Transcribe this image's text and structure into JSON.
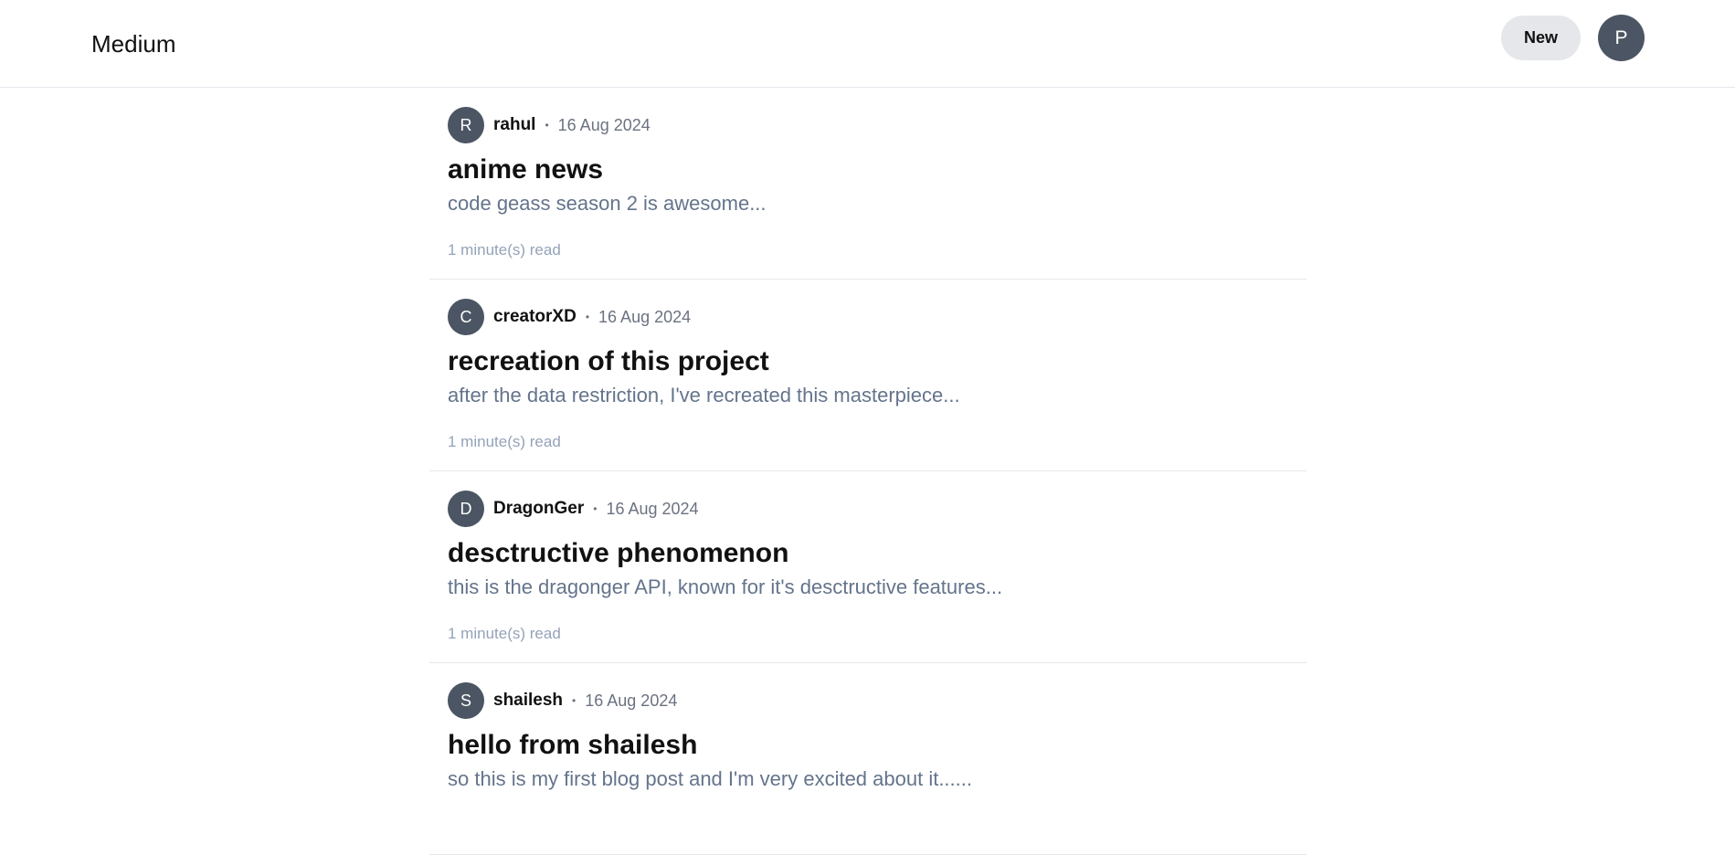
{
  "header": {
    "brand": "Medium",
    "new_label": "New",
    "profile_initial": "P"
  },
  "posts": [
    {
      "initial": "R",
      "author": "rahul",
      "separator": "•",
      "date": "16 Aug 2024",
      "title": "anime news",
      "excerpt": "code geass season 2 is awesome...",
      "read_time": "1 minute(s) read"
    },
    {
      "initial": "C",
      "author": "creatorXD",
      "separator": "•",
      "date": "16 Aug 2024",
      "title": "recreation of this project",
      "excerpt": "after the data restriction, I've recreated this masterpiece...",
      "read_time": "1 minute(s) read"
    },
    {
      "initial": "D",
      "author": "DragonGer",
      "separator": "•",
      "date": "16 Aug 2024",
      "title": "desctructive phenomenon",
      "excerpt": "this is the dragonger API, known for it's desctructive features...",
      "read_time": "1 minute(s) read"
    },
    {
      "initial": "S",
      "author": "shailesh",
      "separator": "•",
      "date": "16 Aug 2024",
      "title": "hello from shailesh",
      "excerpt": "so this is my first blog post and I'm very excited about it......",
      "read_time": ""
    }
  ]
}
